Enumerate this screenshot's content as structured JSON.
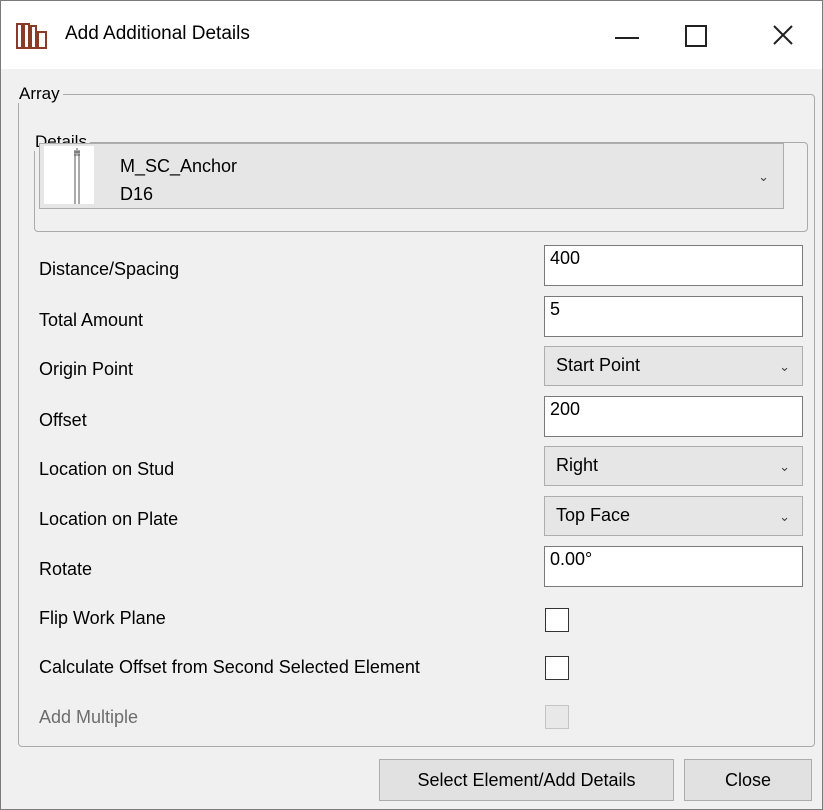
{
  "window": {
    "title": "Add Additional Details"
  },
  "array_group": {
    "legend": "Array"
  },
  "details_group": {
    "legend": "Details",
    "selected_name": "M_SC_Anchor",
    "selected_size": "D16"
  },
  "fields": {
    "distance_spacing": {
      "label": "Distance/Spacing",
      "value": "400"
    },
    "total_amount": {
      "label": "Total Amount",
      "value": "5"
    },
    "origin_point": {
      "label": "Origin Point",
      "value": "Start Point"
    },
    "offset": {
      "label": "Offset",
      "value": "200"
    },
    "location_on_stud": {
      "label": "Location on Stud",
      "value": "Right"
    },
    "location_on_plate": {
      "label": "Location on Plate",
      "value": "Top Face"
    },
    "rotate": {
      "label": "Rotate",
      "value": "0.00°"
    },
    "flip_work_plane": {
      "label": "Flip Work Plane",
      "checked": false
    },
    "calc_offset": {
      "label": "Calculate Offset from Second Selected Element",
      "checked": false
    },
    "add_multiple": {
      "label": "Add Multiple",
      "checked": false,
      "enabled": false
    }
  },
  "buttons": {
    "select_element": "Select Element/Add Details",
    "close": "Close"
  },
  "icons": {
    "app": "bookshelf-icon",
    "minimize": "minimize-icon",
    "maximize": "maximize-icon",
    "close": "close-icon",
    "dropdown": "chevron-down-icon"
  },
  "colors": {
    "background": "#f0f0f0",
    "titlebar": "#ffffff",
    "app_icon": "#8b3a2a"
  }
}
